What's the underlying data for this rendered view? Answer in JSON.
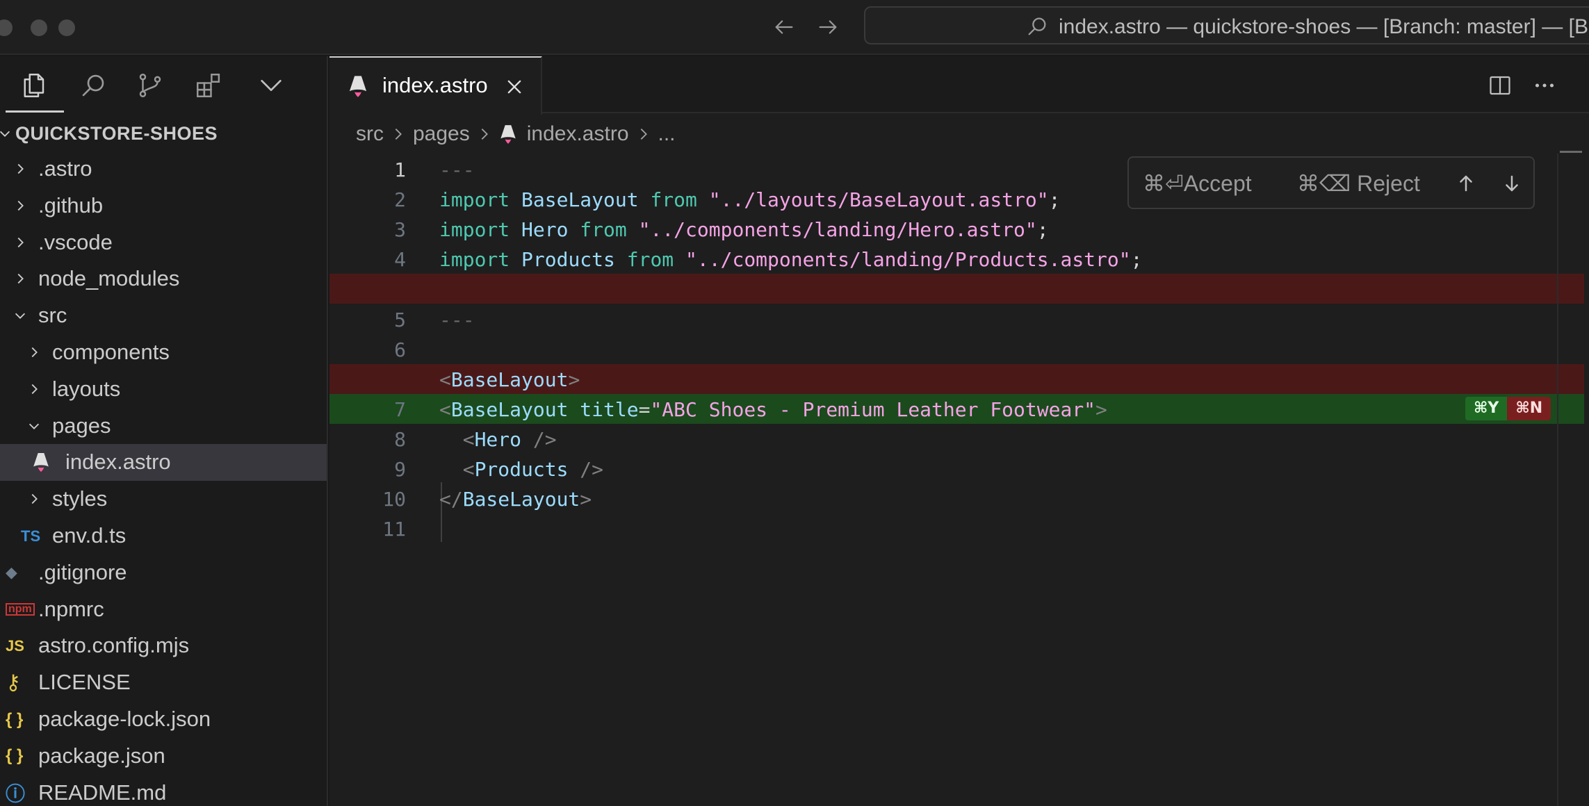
{
  "titlebar": {
    "command_center_text": "index.astro — quickstore-shoes — [Branch: master] — [B",
    "icons": [
      "back-arrow-icon",
      "forward-arrow-icon",
      "search-icon"
    ]
  },
  "activity": {
    "icons": [
      "files-icon",
      "search-icon",
      "source-control-icon",
      "extensions-icon",
      "chevron-down-icon"
    ]
  },
  "explorer": {
    "title": "QUICKSTORE-SHOES",
    "items": [
      {
        "label": ".astro",
        "kind": "folder",
        "expanded": false,
        "depth": 0
      },
      {
        "label": ".github",
        "kind": "folder",
        "expanded": false,
        "depth": 0
      },
      {
        "label": ".vscode",
        "kind": "folder",
        "expanded": false,
        "depth": 0
      },
      {
        "label": "node_modules",
        "kind": "folder",
        "expanded": false,
        "depth": 0
      },
      {
        "label": "src",
        "kind": "folder",
        "expanded": true,
        "depth": 0
      },
      {
        "label": "components",
        "kind": "folder",
        "expanded": false,
        "depth": 1
      },
      {
        "label": "layouts",
        "kind": "folder",
        "expanded": false,
        "depth": 1
      },
      {
        "label": "pages",
        "kind": "folder",
        "expanded": true,
        "depth": 1
      },
      {
        "label": "index.astro",
        "kind": "astro",
        "depth": 2,
        "selected": true
      },
      {
        "label": "styles",
        "kind": "folder",
        "expanded": false,
        "depth": 1
      },
      {
        "label": "env.d.ts",
        "kind": "ts",
        "icon_text": "TS",
        "depth": 1
      },
      {
        "label": ".gitignore",
        "kind": "git",
        "depth": 0
      },
      {
        "label": ".npmrc",
        "kind": "npm",
        "icon_text": "npm",
        "depth": 0
      },
      {
        "label": "astro.config.mjs",
        "kind": "js",
        "icon_text": "JS",
        "depth": 0
      },
      {
        "label": "LICENSE",
        "kind": "license",
        "depth": 0
      },
      {
        "label": "package-lock.json",
        "kind": "json",
        "icon_text": "{ }",
        "depth": 0
      },
      {
        "label": "package.json",
        "kind": "json",
        "icon_text": "{ }",
        "depth": 0
      },
      {
        "label": "README.md",
        "kind": "info",
        "depth": 0
      }
    ]
  },
  "editor": {
    "tab_label": "index.astro",
    "breadcrumb": [
      "src",
      "pages",
      "index.astro",
      "..."
    ],
    "diff_widget": {
      "accept": "⌘⏎Accept",
      "reject": "⌘⌫ Reject"
    },
    "inline_keys": {
      "accept": "⌘Y",
      "reject": "⌘N"
    },
    "lines": [
      {
        "num": "1",
        "kind": "normal",
        "current": true,
        "tokens": [
          [
            "dash",
            "---"
          ]
        ]
      },
      {
        "num": "2",
        "kind": "normal",
        "tokens": [
          [
            "kw",
            "import "
          ],
          [
            "id",
            "BaseLayout"
          ],
          [
            "kw",
            " from "
          ],
          [
            "str",
            "\"../layouts/BaseLayout.astro\""
          ],
          [
            "punct",
            ";"
          ]
        ]
      },
      {
        "num": "3",
        "kind": "normal",
        "tokens": [
          [
            "kw",
            "import "
          ],
          [
            "id",
            "Hero"
          ],
          [
            "kw",
            " from "
          ],
          [
            "str",
            "\"../components/landing/Hero.astro\""
          ],
          [
            "punct",
            ";"
          ]
        ]
      },
      {
        "num": "4",
        "kind": "normal",
        "tokens": [
          [
            "kw",
            "import "
          ],
          [
            "id",
            "Products"
          ],
          [
            "kw",
            " from "
          ],
          [
            "str",
            "\"../components/landing/Products.astro\""
          ],
          [
            "punct",
            ";"
          ]
        ]
      },
      {
        "num": "",
        "kind": "removed",
        "tokens": []
      },
      {
        "num": "5",
        "kind": "normal",
        "tokens": [
          [
            "dash",
            "---"
          ]
        ]
      },
      {
        "num": "6",
        "kind": "normal",
        "tokens": []
      },
      {
        "num": "",
        "kind": "removed",
        "tokens": [
          [
            "br",
            "<"
          ],
          [
            "tag",
            "BaseLayout"
          ],
          [
            "br",
            ">"
          ]
        ]
      },
      {
        "num": "7",
        "kind": "added",
        "keys": true,
        "tokens": [
          [
            "br",
            "<"
          ],
          [
            "tag",
            "BaseLayout"
          ],
          [
            "attr",
            " title"
          ],
          [
            "punct",
            "="
          ],
          [
            "str",
            "\"ABC Shoes - Premium Leather Footwear\""
          ],
          [
            "br",
            ">"
          ]
        ]
      },
      {
        "num": "8",
        "kind": "normal",
        "tokens": [
          [
            "punct",
            "  "
          ],
          [
            "br",
            "<"
          ],
          [
            "tag",
            "Hero"
          ],
          [
            "br",
            " />"
          ]
        ]
      },
      {
        "num": "9",
        "kind": "normal",
        "tokens": [
          [
            "punct",
            "  "
          ],
          [
            "br",
            "<"
          ],
          [
            "tag",
            "Products"
          ],
          [
            "br",
            " />"
          ]
        ]
      },
      {
        "num": "10",
        "kind": "normal",
        "tokens": [
          [
            "br",
            "</"
          ],
          [
            "tag",
            "BaseLayout"
          ],
          [
            "br",
            ">"
          ]
        ]
      },
      {
        "num": "11",
        "kind": "normal",
        "tokens": []
      }
    ]
  },
  "colors": {
    "removed_line": "#4b1818",
    "added_line": "#1b4a1d",
    "keyword": "#4ec9b0",
    "string": "#f5a3e6",
    "identifier": "#9cdcfe",
    "astro_accent": "#ff5a9e"
  }
}
